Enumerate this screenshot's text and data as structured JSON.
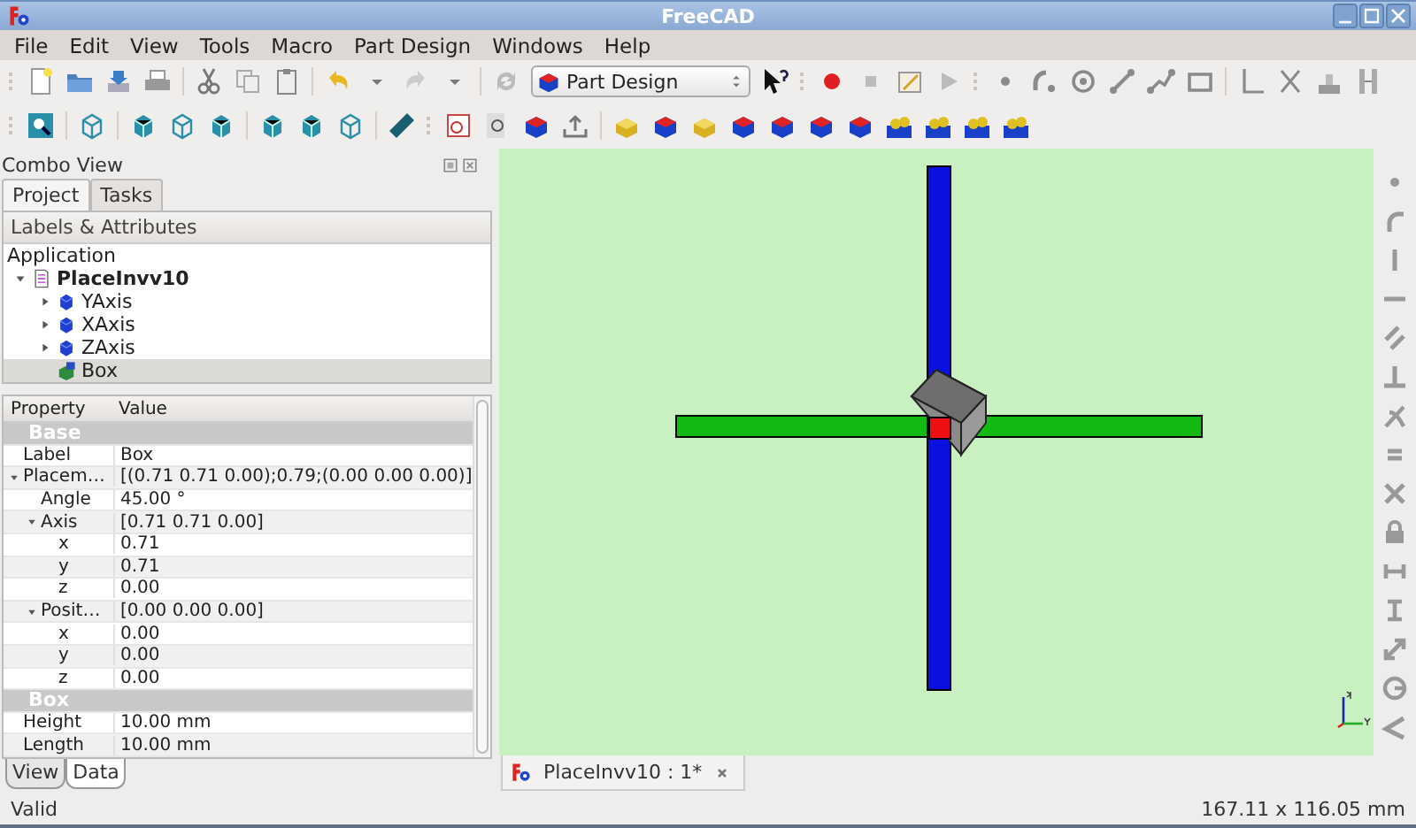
{
  "window": {
    "title": "FreeCAD"
  },
  "menu": [
    "File",
    "Edit",
    "View",
    "Tools",
    "Macro",
    "Part Design",
    "Windows",
    "Help"
  ],
  "toolbar": {
    "workbench": "Part Design"
  },
  "combo_view": {
    "title": "Combo View",
    "tabs": [
      {
        "label": "Project",
        "selected": true
      },
      {
        "label": "Tasks",
        "selected": false
      }
    ],
    "tree": {
      "header": "Labels & Attributes",
      "root": "Application",
      "items": [
        {
          "label": "PlaceInvv10",
          "kind": "document",
          "expanded": true,
          "selected": false,
          "children": [
            {
              "label": "YAxis",
              "kind": "solid",
              "expanded": false,
              "selected": false
            },
            {
              "label": "XAxis",
              "kind": "solid",
              "expanded": false,
              "selected": false
            },
            {
              "label": "ZAxis",
              "kind": "solid",
              "expanded": false,
              "selected": false
            },
            {
              "label": "Box",
              "kind": "box",
              "selected": true
            }
          ]
        }
      ]
    },
    "properties": {
      "columns": [
        "Property",
        "Value"
      ],
      "groups": [
        {
          "name": "Base",
          "rows": [
            {
              "property": "Label",
              "value": "Box"
            },
            {
              "property": "Placem…",
              "value": "[(0.71 0.71 0.00);0.79;(0.00 0.00 0.00)]",
              "expanded": true,
              "children": [
                {
                  "property": "Angle",
                  "value": "45.00 °"
                },
                {
                  "property": "Axis",
                  "value": "[0.71 0.71 0.00]",
                  "expanded": true,
                  "children": [
                    {
                      "property": "x",
                      "value": "0.71"
                    },
                    {
                      "property": "y",
                      "value": "0.71"
                    },
                    {
                      "property": "z",
                      "value": "0.00"
                    }
                  ]
                },
                {
                  "property": "Posit…",
                  "value": "[0.00 0.00 0.00]",
                  "expanded": true,
                  "children": [
                    {
                      "property": "x",
                      "value": "0.00"
                    },
                    {
                      "property": "y",
                      "value": "0.00"
                    },
                    {
                      "property": "z",
                      "value": "0.00"
                    }
                  ]
                }
              ]
            }
          ]
        },
        {
          "name": "Box",
          "rows": [
            {
              "property": "Height",
              "value": "10.00 mm"
            },
            {
              "property": "Length",
              "value": "10.00 mm"
            }
          ]
        }
      ]
    },
    "bottom_tabs": [
      {
        "label": "View",
        "selected": false
      },
      {
        "label": "Data",
        "selected": true
      }
    ]
  },
  "document_tabs": [
    {
      "label": "PlaceInvv10 : 1*"
    }
  ],
  "status_bar": {
    "message": "Valid",
    "dimensions": "167.11 x 116.05 mm"
  }
}
